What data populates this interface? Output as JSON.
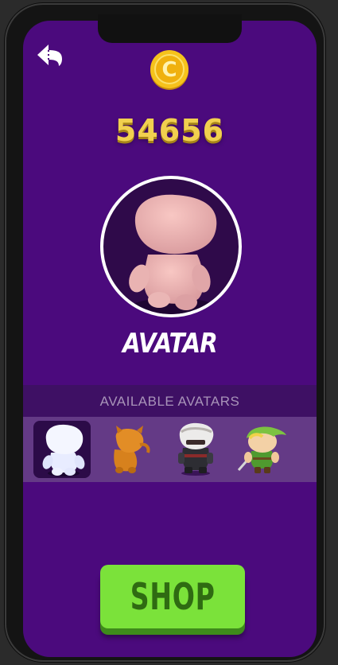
{
  "header": {
    "back_icon": "back-arrow-icon",
    "coin_icon": "coin-icon",
    "coin_glyph": "C",
    "coin_count": "54656"
  },
  "current_avatar": {
    "title": "AVATAR"
  },
  "avatars_section": {
    "title": "AVAILABLE AVATARS",
    "items": [
      {
        "name": "white-blob",
        "selected": true
      },
      {
        "name": "orange-cat",
        "selected": false
      },
      {
        "name": "ninja-warrior",
        "selected": false
      },
      {
        "name": "green-elf-hero",
        "selected": false
      }
    ]
  },
  "shop_button": {
    "label": "SHOP"
  },
  "colors": {
    "background": "#4b0a7d",
    "coin_gold": "#f1d04f",
    "shop_green": "#7be23a",
    "section_bar": "#3e1064",
    "strip": "#643a86"
  }
}
